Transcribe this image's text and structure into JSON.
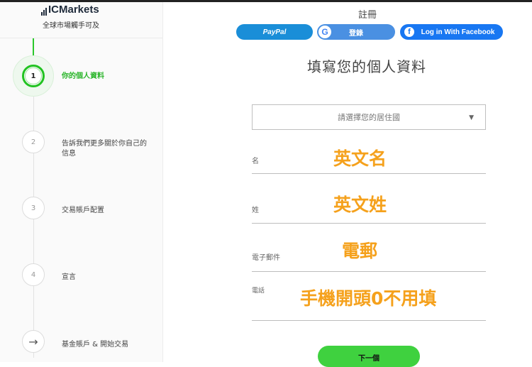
{
  "brand": {
    "logo_text": "Markets",
    "logo_ic": "IC",
    "tagline": "全球市場觸手可及"
  },
  "steps": [
    {
      "number": "1",
      "label": "你的個人資料",
      "active": true
    },
    {
      "number": "2",
      "label": "告訴我們更多關於你自己的信息",
      "active": false
    },
    {
      "number": "3",
      "label": "交易賬戶配置",
      "active": false
    },
    {
      "number": "4",
      "label": "宣言",
      "active": false
    },
    {
      "number": "→",
      "label": "基金賬戶 & 開始交易",
      "active": false
    }
  ],
  "register": {
    "title": "註冊",
    "paypal_label": "PayPal",
    "google_label": "登錄",
    "google_glyph": "G",
    "facebook_label": "Log in With Facebook",
    "facebook_glyph": "f"
  },
  "form": {
    "title": "填寫您的個人資料",
    "country_placeholder": "請選擇您的居住國",
    "first_name": {
      "label": "名",
      "value": "英文名"
    },
    "last_name": {
      "label": "姓",
      "value": "英文姓"
    },
    "email": {
      "label": "電子郵件",
      "value": "電郵"
    },
    "phone": {
      "label": "電話",
      "value": "手機開頭0不用填"
    },
    "next_label": "下一個"
  },
  "colors": {
    "active_green": "#22c322",
    "button_green": "#3fd13f",
    "annotation_orange": "#f5a11c",
    "paypal_blue": "#1a8ed8",
    "google_blue": "#4a90e2",
    "facebook_blue": "#1877f2"
  },
  "icons": {
    "dropdown": "caret-down-icon",
    "step5": "arrow-right-icon"
  }
}
